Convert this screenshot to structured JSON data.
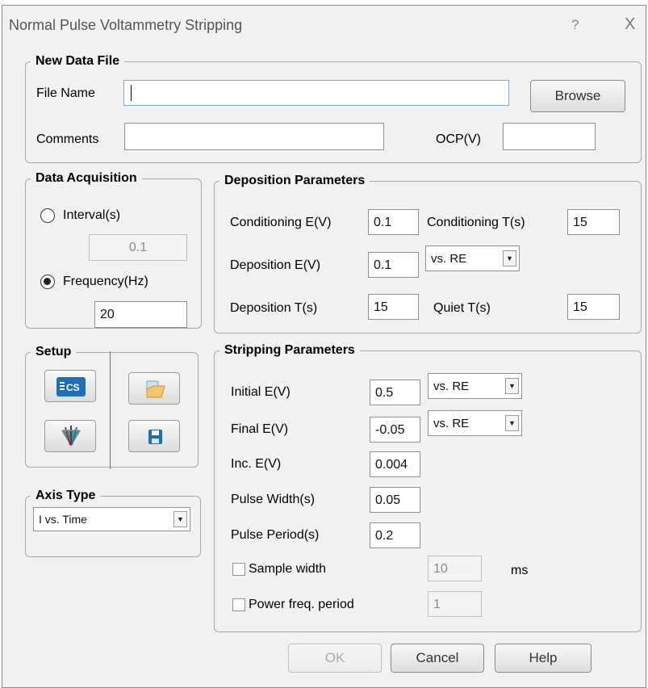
{
  "window": {
    "title": "Normal Pulse Voltammetry Stripping",
    "help_glyph": "?",
    "close_glyph": "X"
  },
  "new_data_file": {
    "legend": "New Data File",
    "file_name_label": "File Name",
    "file_name_value": "",
    "browse_label": "Browse",
    "comments_label": "Comments",
    "comments_value": "",
    "ocp_label": "OCP(V)",
    "ocp_value": ""
  },
  "data_acquisition": {
    "legend": "Data Acquisition",
    "interval_label": "Interval(s)",
    "interval_value": "0.1",
    "interval_selected": false,
    "frequency_label": "Frequency(Hz)",
    "frequency_value": "20",
    "frequency_selected": true
  },
  "deposition": {
    "legend": "Deposition Parameters",
    "cond_e_label": "Conditioning E(V)",
    "cond_e_value": "0.1",
    "cond_t_label": "Conditioning T(s)",
    "cond_t_value": "15",
    "dep_e_label": "Deposition E(V)",
    "dep_e_value": "0.1",
    "dep_e_ref": "vs. RE",
    "dep_t_label": "Deposition T(s)",
    "dep_t_value": "15",
    "quiet_t_label": "Quiet T(s)",
    "quiet_t_value": "15"
  },
  "setup": {
    "legend": "Setup",
    "icons": [
      "cs-instrument-icon",
      "open-folder-icon",
      "electrode-icon",
      "save-disk-icon"
    ]
  },
  "stripping": {
    "legend": "Stripping Parameters",
    "initial_e_label": "Initial E(V)",
    "initial_e_value": "0.5",
    "initial_e_ref": "vs. RE",
    "final_e_label": "Final E(V)",
    "final_e_value": "-0.05",
    "final_e_ref": "vs. RE",
    "inc_e_label": "Inc. E(V)",
    "inc_e_value": "0.004",
    "pulse_width_label": "Pulse Width(s)",
    "pulse_width_value": "0.05",
    "pulse_period_label": "Pulse Period(s)",
    "pulse_period_value": "0.2",
    "sample_width_label": "Sample width",
    "sample_width_value": "10",
    "sample_width_unit": "ms",
    "sample_width_checked": false,
    "power_freq_label": "Power freq. period",
    "power_freq_value": "1",
    "power_freq_checked": false
  },
  "axis_type": {
    "legend": "Axis Type",
    "selected": "I vs. Time"
  },
  "buttons": {
    "ok": "OK",
    "cancel": "Cancel",
    "help": "Help"
  },
  "colors": {
    "dialog_bg": "#f1f1f1",
    "border": "#a8a8a8",
    "focus_border": "#7ea7cf",
    "icon_blue": "#1f6fb8"
  }
}
